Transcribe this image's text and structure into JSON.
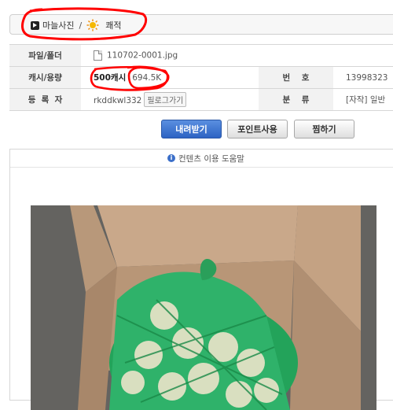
{
  "breadcrumb": {
    "category": "마늘사진",
    "separator": "/",
    "subcategory": "쾌적"
  },
  "info": {
    "file_label": "파일/폴더",
    "file_name": "110702-0001.jpg",
    "points_label": "캐시/용량",
    "points": "500캐시",
    "size": "694.5K",
    "number_label": "번    호",
    "number": "13998323",
    "uploader_label": "등  록  자",
    "uploader": "rkddkwl332",
    "blog_button": "필로그가기",
    "category_label": "분    류",
    "category": "[자작] 일반"
  },
  "actions": {
    "download": "내려받기",
    "use_points": "포인트사용",
    "bookmark": "찜하기"
  },
  "help": {
    "text": "컨텐츠 이용 도움말"
  },
  "colors": {
    "annotation": "#ff0000",
    "download_button": "#2d63c3"
  }
}
